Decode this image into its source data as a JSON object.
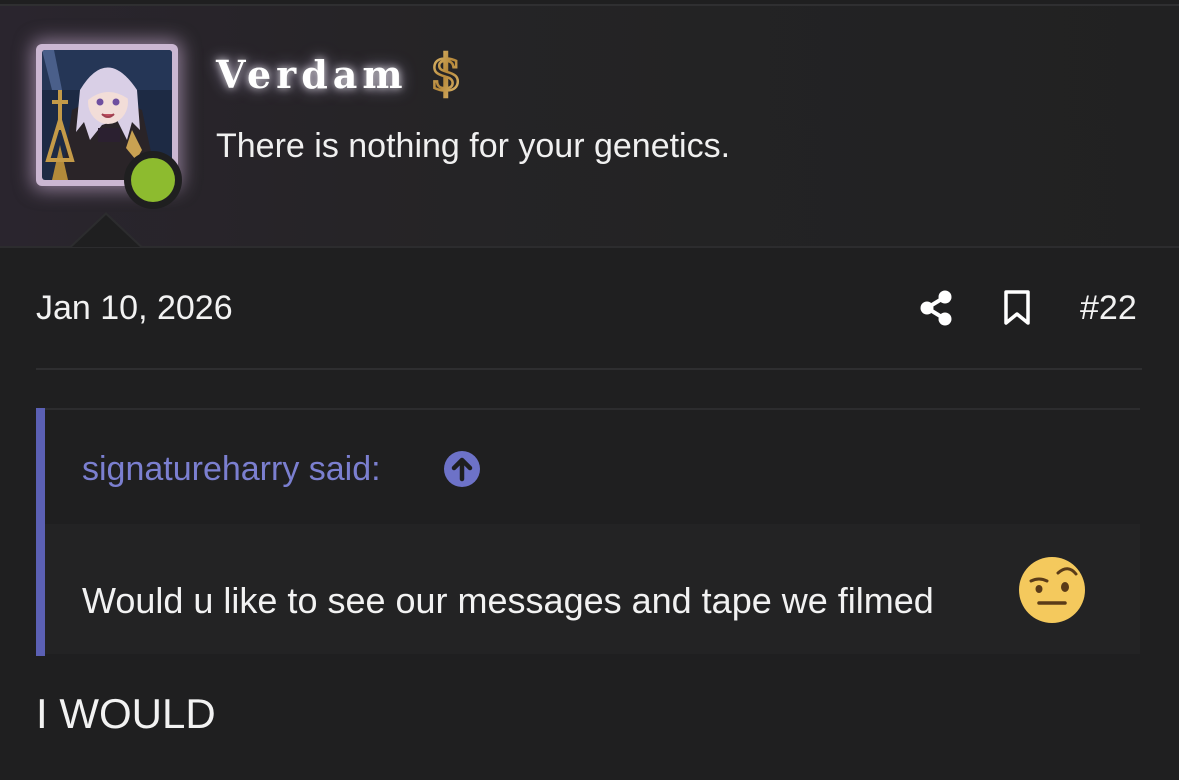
{
  "user": {
    "name": "Verdam",
    "title": "There is nothing for your genetics.",
    "online": true,
    "badge_icon": "dollar-sign-icon",
    "accent_color": "#8dbb2f"
  },
  "post": {
    "date": "Jan 10, 2026",
    "number": "#22",
    "actions": [
      "share-icon",
      "bookmark-icon"
    ]
  },
  "quote": {
    "author": "signatureharry said:",
    "text": "Would u like to see our messages and tape we filmed",
    "emoji": "face-with-raised-eyebrow-icon",
    "accent_color": "#5b60b4"
  },
  "reply": {
    "text": "I WOULD"
  }
}
